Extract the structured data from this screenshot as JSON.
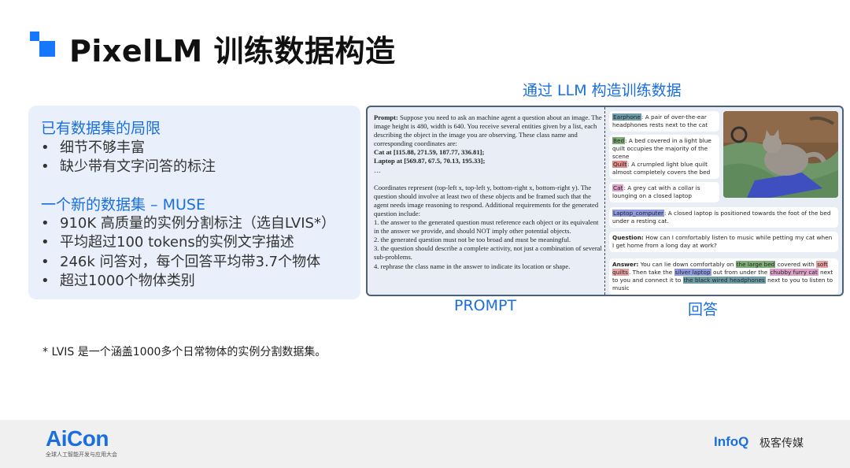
{
  "title": "PixelLM 训练数据构造",
  "colors": {
    "accent": "#1677ff",
    "panel_bg": "#e9f0fb",
    "figure_border": "#4c6078"
  },
  "left_panel": {
    "heading1": "已有数据集的局限",
    "items1": [
      "细节不够丰富",
      "缺少带有文字问答的标注"
    ],
    "heading2": "一个新的数据集 – MUSE",
    "items2": [
      "910K 高质量的实例分割标注（选自LVIS*）",
      "平均超过100 tokens的实例文字描述",
      "246k 问答对，每个回答平均带3.7个物体",
      "超过1000个物体类别"
    ],
    "bullet": "•"
  },
  "right_heading": "通过 LLM 构造训练数据",
  "prompt": {
    "label": "Prompt:",
    "intro": "Suppose you need to ask an machine agent a question about an image. The image height is 480, width is 640. You receive several entities given by a list, each describing the object in the image you are observing. These class name and corresponding coordinates are:",
    "line_cat": "Cat at [115.88, 271.59, 187.77, 336.81];",
    "line_laptop": "Laptop at [569.87, 67.5, 70.13, 195.33];",
    "ellipsis": "…",
    "requirements": "Coordinates represent (top-left x, top-left y, bottom-right x, bottom-right y). The question should involve at least two of these objects and be framed such that the agent needs image reasoning to respond. Additional requirements for the generated question include:",
    "r1": "1. the answer to the generated question must reference each object or its equivalent in the answer we provide, and should NOT imply other potential objects.",
    "r2": "2. the generated question must not be too broad and must be meaningful.",
    "r3": "3. the question should describe a complete activity, not just a combination of several sub-problems.",
    "r4": "4. rephrase the class name in the answer to indicate its location or shape."
  },
  "descriptions": {
    "earphone_tag": "Earphone",
    "earphone_text": ": A pair of over-the-ear headphones rests next to the cat",
    "bed_tag": "Bed",
    "bed_text": ": A bed covered in a light blue quilt occupies the majority of the scene",
    "quilt_tag": "Quilt",
    "quilt_text": ": A crumpled light blue quilt almost completely covers the bed",
    "cat_tag": "Cat",
    "cat_text": ": A grey cat with a collar is lounging on a closed laptop",
    "laptop_tag": "Laptop_computer",
    "laptop_text": ": A closed laptop  is positioned towards the foot of the bed under a resting cat."
  },
  "question": {
    "label": "Question:",
    "text": " How can I comfortably listen to music while petting my cat when I get home from a long day at work?"
  },
  "answer": {
    "label": "Answer:",
    "t1": " You can lie down comfortably on ",
    "h1": "the large bed",
    "t2": " covered with ",
    "h2": "soft quilts",
    "t3": ". Then take the ",
    "h3": "silver laptop",
    "t4": "  out from under the ",
    "h4": "chubby furry cat",
    "t5": "  next to you and connect it to ",
    "h5": "the black wired headphones",
    "t6": " next to you to listen to music"
  },
  "captions": {
    "prompt": "PROMPT",
    "answer": "回答"
  },
  "footnote": "* LVIS 是一个涵盖1000多个日常物体的实例分割数据集。",
  "footer": {
    "aicon_logo": "AiCon",
    "aicon_sub": "全球人工智能开发与应用大会",
    "infoq_logo": "InfoQ",
    "infoq_cn": "极客传媒"
  }
}
